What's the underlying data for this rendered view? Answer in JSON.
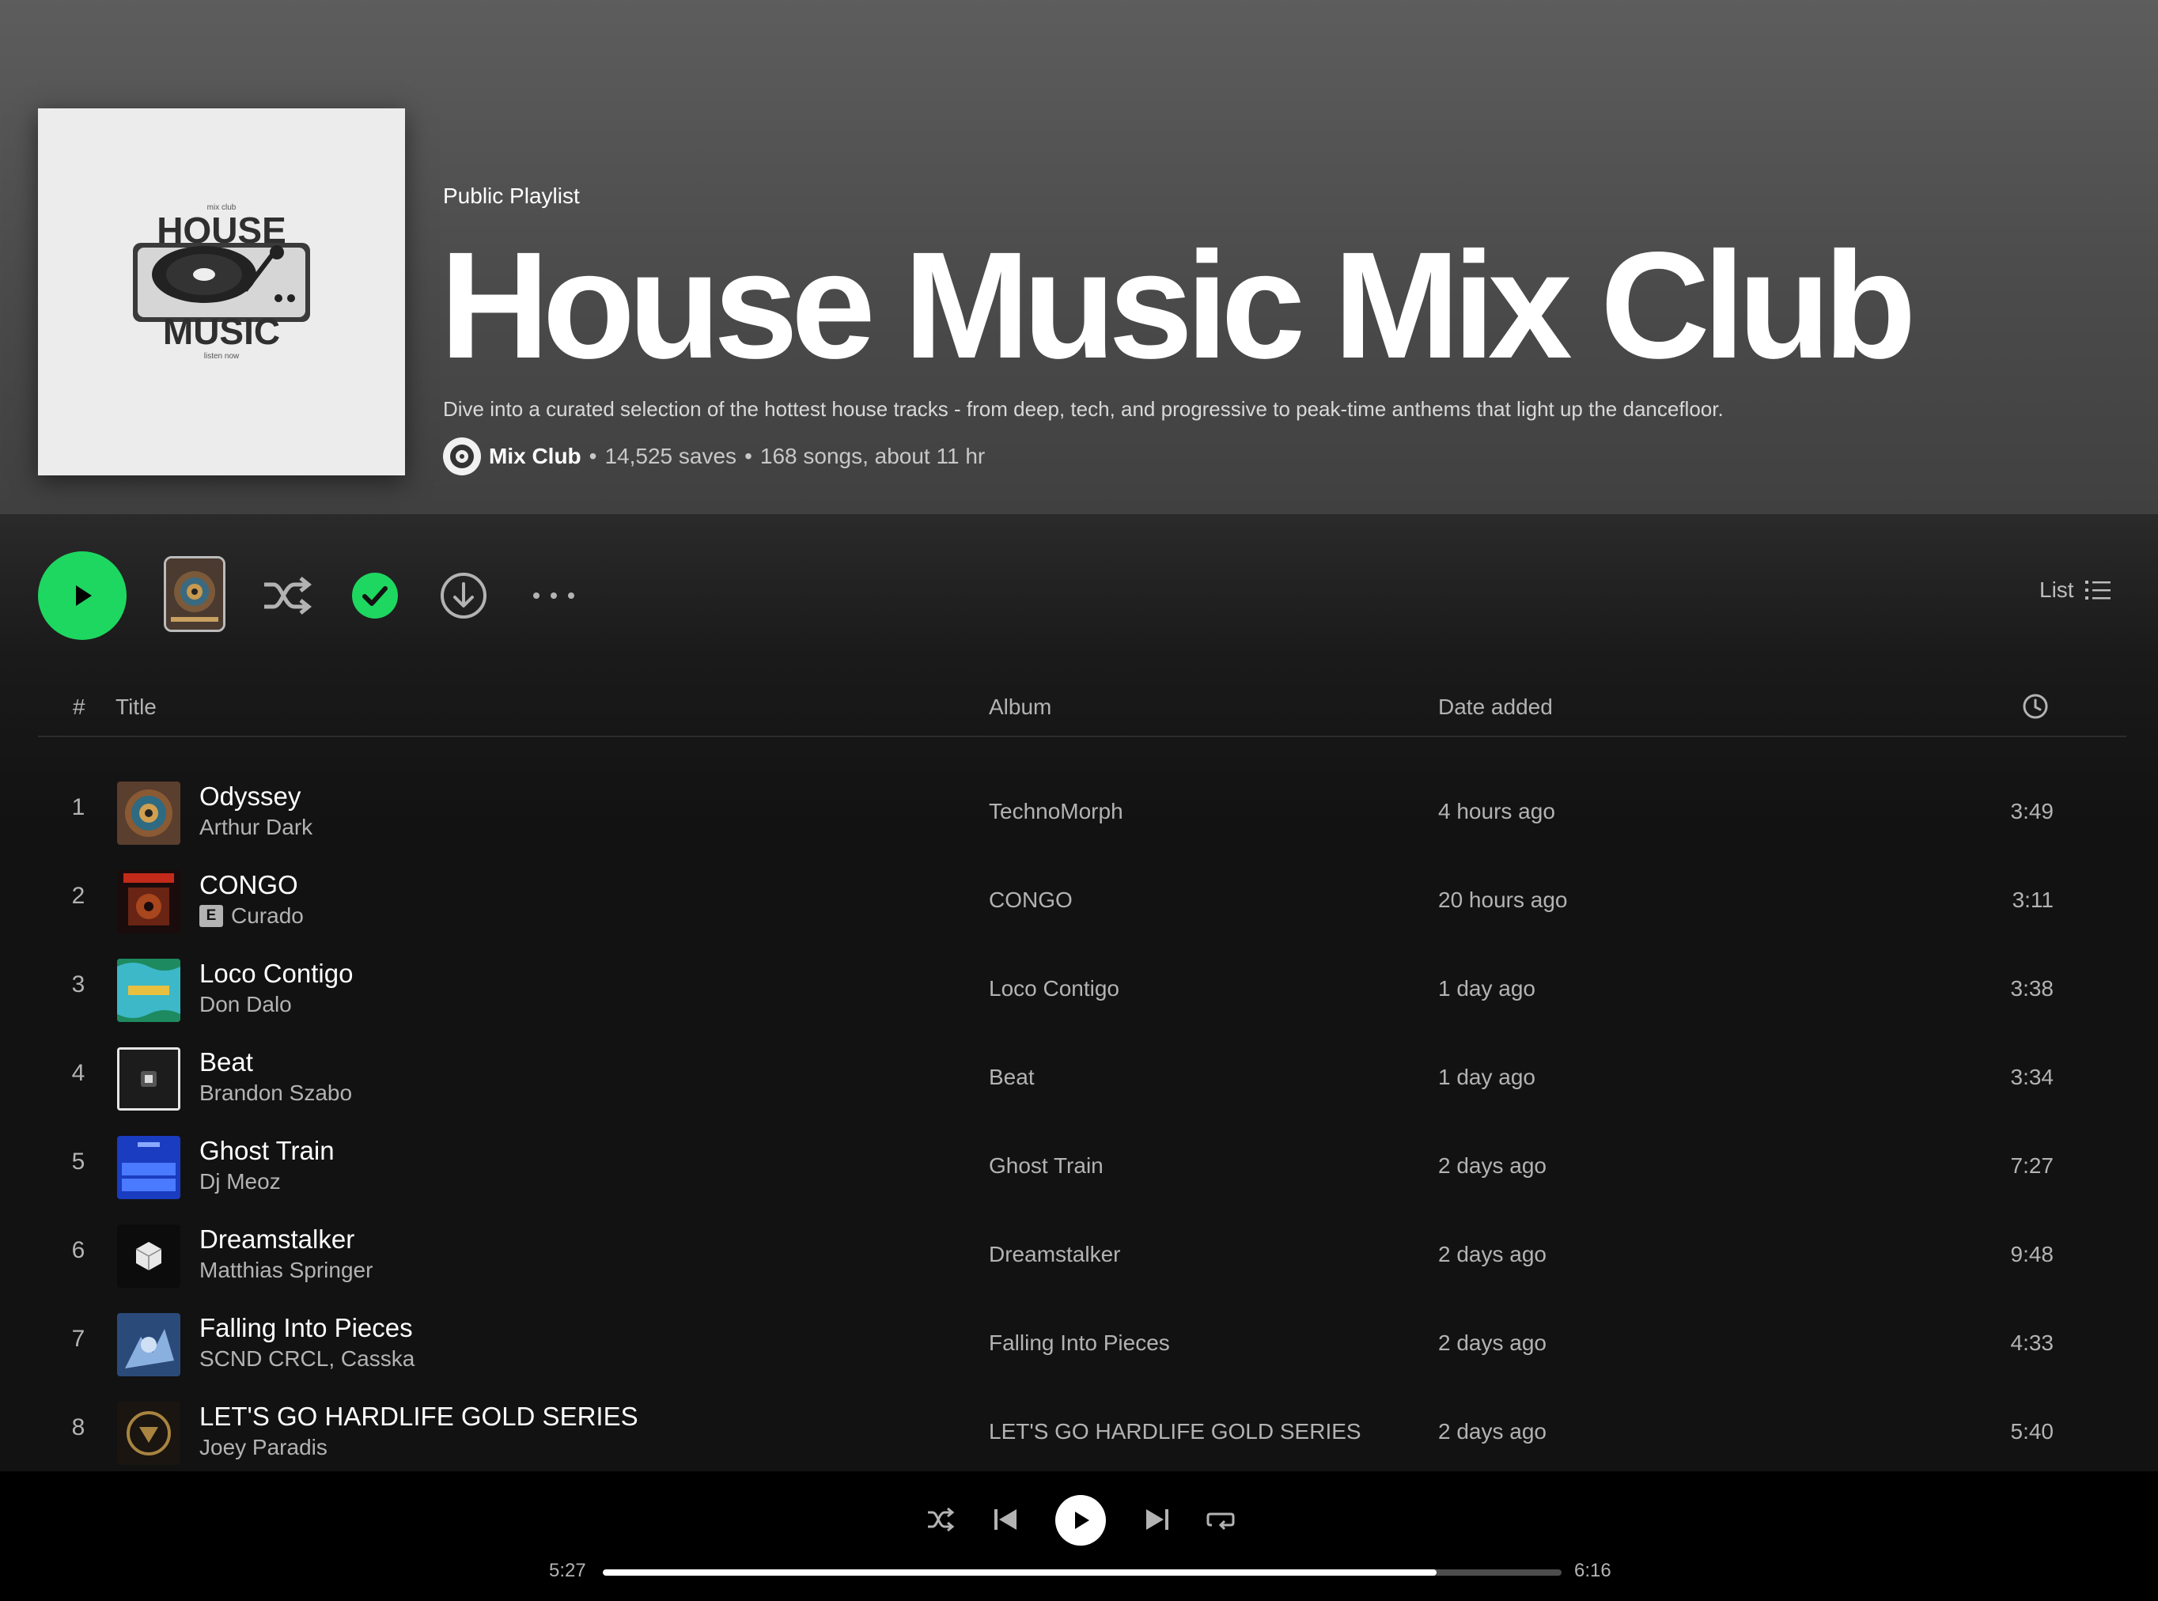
{
  "playlist": {
    "type": "Public Playlist",
    "title": "House Music Mix Club",
    "description": "Dive into a curated selection of the hottest house tracks - from deep, tech, and progressive to peak-time anthems that light up the dancefloor.",
    "owner": "Mix Club",
    "saves": "14,525 saves",
    "summary": "168 songs, about 11 hr",
    "cover_text": {
      "top": "mix club",
      "line1": "HOUSE",
      "line2": "MUSIC",
      "bottom": "listen now"
    }
  },
  "controls": {
    "play_icon": "play-icon",
    "shuffle_icon": "shuffle-icon",
    "saved_icon": "check-circle-icon",
    "download_icon": "download-icon",
    "more_icon": "more-icon",
    "view_label": "List",
    "view_icon": "list-icon",
    "accent_color": "#1ed760"
  },
  "table": {
    "headers": {
      "num": "#",
      "title": "Title",
      "album": "Album",
      "date": "Date added",
      "duration_icon": "clock-icon"
    },
    "tracks": [
      {
        "num": "1",
        "title": "Odyssey",
        "artist": "Arthur Dark",
        "explicit": false,
        "album": "TechnoMorph",
        "date": "4 hours ago",
        "duration": "3:49"
      },
      {
        "num": "2",
        "title": "CONGO",
        "artist": "Curado",
        "explicit": true,
        "explicit_label": "E",
        "album": "CONGO",
        "date": "20 hours ago",
        "duration": "3:11"
      },
      {
        "num": "3",
        "title": "Loco Contigo",
        "artist": "Don Dalo",
        "explicit": false,
        "album": "Loco Contigo",
        "date": "1 day ago",
        "duration": "3:38"
      },
      {
        "num": "4",
        "title": "Beat",
        "artist": "Brandon Szabo",
        "explicit": false,
        "album": "Beat",
        "date": "1 day ago",
        "duration": "3:34"
      },
      {
        "num": "5",
        "title": "Ghost Train",
        "artist": "Dj Meoz",
        "explicit": false,
        "album": "Ghost Train",
        "date": "2 days ago",
        "duration": "7:27"
      },
      {
        "num": "6",
        "title": "Dreamstalker",
        "artist": "Matthias Springer",
        "explicit": false,
        "album": "Dreamstalker",
        "date": "2 days ago",
        "duration": "9:48"
      },
      {
        "num": "7",
        "title": "Falling Into Pieces",
        "artist": "SCND CRCL, Casska",
        "explicit": false,
        "album": "Falling Into Pieces",
        "date": "2 days ago",
        "duration": "4:33"
      },
      {
        "num": "8",
        "title": "LET'S GO HARDLIFE GOLD SERIES",
        "artist": "Joey Paradis",
        "explicit": false,
        "album": "LET'S GO HARDLIFE GOLD SERIES",
        "date": "2 days ago",
        "duration": "5:40"
      }
    ]
  },
  "player": {
    "elapsed": "5:27",
    "total": "6:16",
    "progress": 0.87,
    "icons": [
      "shuffle-icon",
      "previous-icon",
      "play-icon",
      "next-icon",
      "repeat-icon"
    ]
  }
}
